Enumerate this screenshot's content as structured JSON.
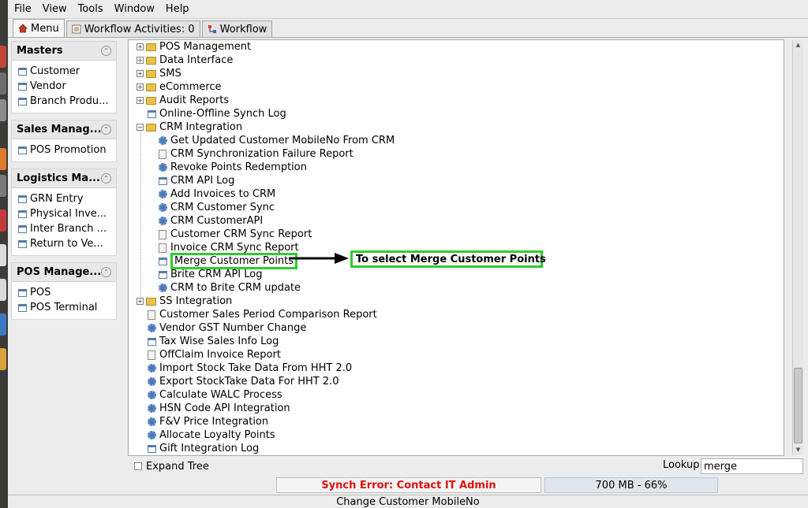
{
  "menubar": [
    "File",
    "View",
    "Tools",
    "Window",
    "Help"
  ],
  "tabs": [
    {
      "label": "Menu",
      "icon": "home-icon"
    },
    {
      "label": "Workflow Activities: 0",
      "icon": "list-icon"
    },
    {
      "label": "Workflow",
      "icon": "workflow-icon"
    }
  ],
  "groups": [
    {
      "title": "Masters",
      "items": [
        "Customer",
        "Vendor",
        "Branch Produ..."
      ]
    },
    {
      "title": "Sales Manag...",
      "items": [
        "POS Promotion"
      ]
    },
    {
      "title": "Logistics Ma...",
      "items": [
        "GRN Entry",
        "Physical Inve...",
        "Inter Branch ...",
        "Return to Ve..."
      ]
    },
    {
      "title": "POS Manage...",
      "items": [
        "POS",
        "POS Terminal"
      ]
    }
  ],
  "tree": [
    {
      "label": "POS Management",
      "type": "folder",
      "level": 0,
      "expand": "+"
    },
    {
      "label": "Data Interface",
      "type": "folder",
      "level": 0,
      "expand": "+"
    },
    {
      "label": "SMS",
      "type": "folder",
      "level": 0,
      "expand": "+"
    },
    {
      "label": "eCommerce",
      "type": "folder",
      "level": 0,
      "expand": "+"
    },
    {
      "label": "Audit Reports",
      "type": "folder",
      "level": 0,
      "expand": "+"
    },
    {
      "label": "Online-Offline Synch Log",
      "type": "window",
      "level": 0
    },
    {
      "label": "CRM Integration",
      "type": "folder",
      "level": 0,
      "expand": "-"
    },
    {
      "label": "Get Updated Customer MobileNo From CRM",
      "type": "process",
      "level": 1
    },
    {
      "label": "CRM Synchronization Failure Report",
      "type": "report",
      "level": 1
    },
    {
      "label": "Revoke Points Redemption",
      "type": "process",
      "level": 1
    },
    {
      "label": "CRM API Log",
      "type": "window",
      "level": 1
    },
    {
      "label": "Add Invoices to CRM",
      "type": "process",
      "level": 1
    },
    {
      "label": "CRM Customer Sync",
      "type": "process",
      "level": 1
    },
    {
      "label": "CRM CustomerAPI",
      "type": "process",
      "level": 1
    },
    {
      "label": "Customer CRM Sync Report",
      "type": "report",
      "level": 1
    },
    {
      "label": "Invoice CRM Sync Report",
      "type": "report",
      "level": 1
    },
    {
      "label": "Merge Customer Points",
      "type": "window",
      "level": 1,
      "highlight": true
    },
    {
      "label": "Brite CRM API Log",
      "type": "window",
      "level": 1
    },
    {
      "label": "CRM to Brite CRM update",
      "type": "process",
      "level": 1
    },
    {
      "label": "SS Integration",
      "type": "folder",
      "level": 0,
      "expand": "+"
    },
    {
      "label": "Customer Sales Period Comparison Report",
      "type": "report",
      "level": 0
    },
    {
      "label": "Vendor GST Number Change",
      "type": "process",
      "level": 0
    },
    {
      "label": "Tax Wise Sales Info Log",
      "type": "window",
      "level": 0
    },
    {
      "label": "OffClaim Invoice Report",
      "type": "report",
      "level": 0
    },
    {
      "label": "Import Stock Take Data From HHT 2.0",
      "type": "process",
      "level": 0
    },
    {
      "label": "Export StockTake Data For HHT 2.0",
      "type": "process",
      "level": 0
    },
    {
      "label": "Calculate WALC Process",
      "type": "process",
      "level": 0
    },
    {
      "label": "HSN Code API Integration",
      "type": "process",
      "level": 0
    },
    {
      "label": "F&V Price Integration",
      "type": "process",
      "level": 0
    },
    {
      "label": "Allocate Loyalty Points",
      "type": "process",
      "level": 0
    },
    {
      "label": "Gift Integration Log",
      "type": "window",
      "level": 0
    }
  ],
  "annotation": {
    "text": "To select Merge Customer Points",
    "color": "#2ecc2e"
  },
  "bottom": {
    "expand_tree_label": "Expand Tree",
    "lookup_label": "Lookup",
    "lookup_value": "merge"
  },
  "status": {
    "error": "Synch Error: Contact IT Admin",
    "error_color": "#e01010",
    "memory": "700 MB - 66%",
    "message": "Change Customer MobileNo"
  }
}
